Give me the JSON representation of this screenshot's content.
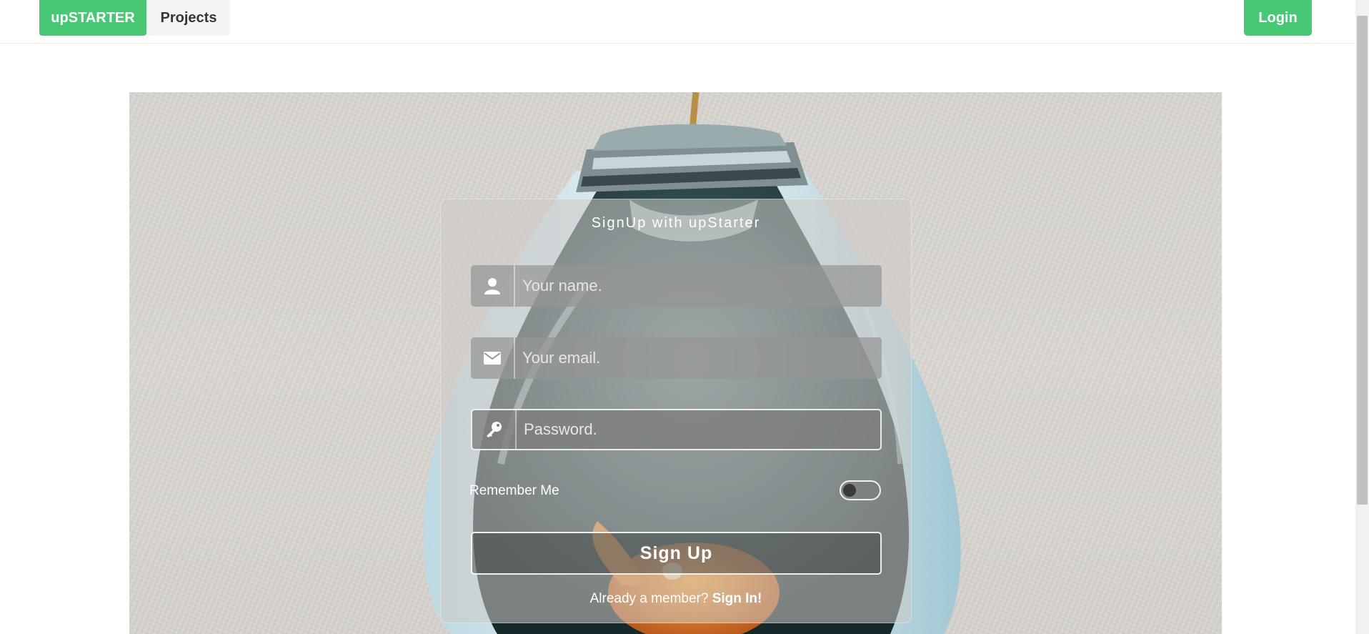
{
  "nav": {
    "brand": "upSTARTER",
    "projects": "Projects",
    "login": "Login"
  },
  "form": {
    "title": "SignUp with upStarter",
    "name_placeholder": "Your name.",
    "email_placeholder": "Your email.",
    "password_placeholder": "Password.",
    "remember_label": "Remember Me",
    "submit_label": "Sign Up",
    "already_text": "Already a member?",
    "signin_link": "Sign In!"
  },
  "icons": {
    "name": "user-icon",
    "email": "envelope-icon",
    "password": "key-icon"
  },
  "colors": {
    "brand_green": "#48c774",
    "nav_button_bg": "#f5f5f5"
  }
}
